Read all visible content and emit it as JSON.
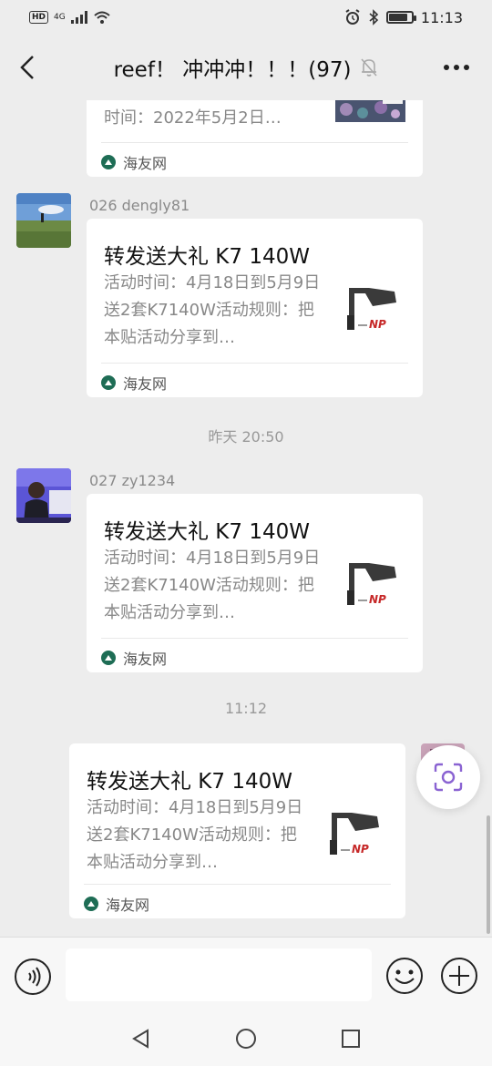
{
  "status_bar": {
    "hd": "HD",
    "network": "4G",
    "time": "11:13"
  },
  "header": {
    "title": "reef！ 冲冲冲！！！(97)",
    "mute_icon": "bell-off-icon"
  },
  "messages": [
    {
      "sender": "",
      "card": {
        "desc_visible": "时间：2022年5月2日…",
        "source": "海友网"
      }
    },
    {
      "sender": "026 dengly81",
      "card": {
        "title": "转发送大礼 K7 140W",
        "desc": "活动时间：4月18日到5月9日送2套K7140W活动规则：把本贴活动分享到…",
        "source": "海友网"
      }
    },
    {
      "timestamp": "昨天 20:50"
    },
    {
      "sender": "027 zy1234",
      "card": {
        "title": "转发送大礼 K7 140W",
        "desc": "活动时间：4月18日到5月9日送2套K7140W活动规则：把本贴活动分享到…",
        "source": "海友网"
      }
    },
    {
      "timestamp": "11:12"
    },
    {
      "sender": "",
      "card": {
        "title": "转发送大礼 K7 140W",
        "desc": "活动时间：4月18日到5月9日送2套K7140W活动规则：把本贴活动分享到…",
        "source": "海友网"
      }
    }
  ],
  "input": {
    "value": "",
    "placeholder": ""
  },
  "colors": {
    "background": "#ededed",
    "source_icon": "#1e6d55",
    "float_icon": "#8a63d2"
  },
  "icons": {
    "back": "chevron-left-icon",
    "more": "ellipsis-icon",
    "voice": "voice-icon",
    "emoji": "emoji-icon",
    "plus": "plus-circle-icon",
    "float": "scan-icon"
  }
}
